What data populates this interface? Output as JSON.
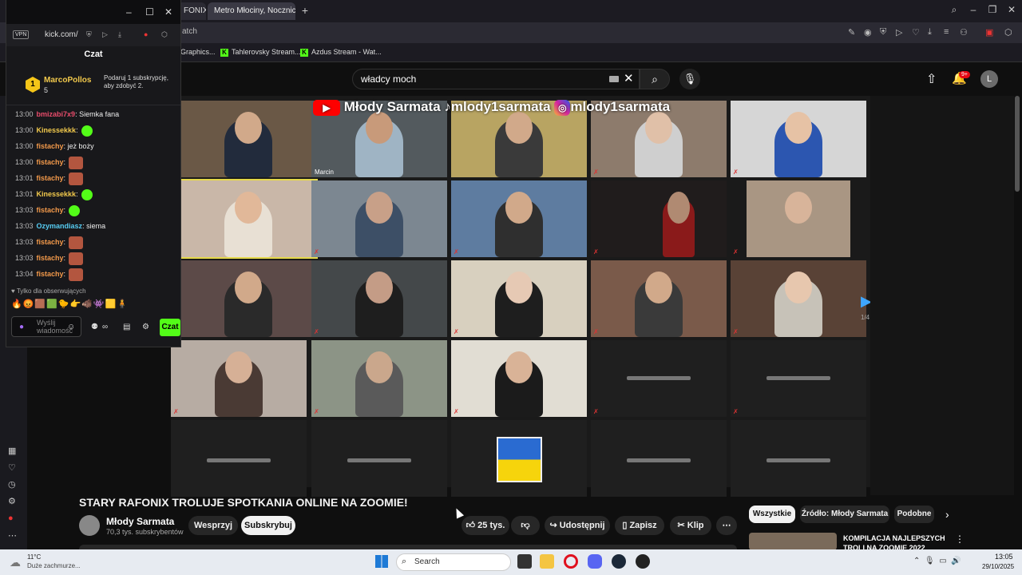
{
  "browser": {
    "tabs": [
      {
        "label": "FONIX"
      },
      {
        "label": "Metro Młociny, Nocznicki"
      }
    ],
    "address_fragment": "atch",
    "bookmarks": [
      "Graphics...",
      "Tahlerovsky Stream...",
      "Azdus Stream - Wat..."
    ]
  },
  "youtube": {
    "search_value": "władcy moch",
    "notification_badge": "9+",
    "avatar_letter": "L",
    "video_title": "STARY RAFONIX TROLUJE SPOTKANIA ONLINE NA ZOOMIE!",
    "channel_name": "Młody Sarmata",
    "channel_subs": "70,3 tys. subskrybentów",
    "support_label": "Wesprzyj",
    "subscribe_label": "Subskrybuj",
    "like_count": "25 tys.",
    "share_label": "Udostępnij",
    "save_label": "Zapisz",
    "clip_label": "Klip",
    "chips": [
      "Wszystkie",
      "Źródło: Młody Sarmata",
      "Podobne"
    ],
    "rec_title": "KOMPILACJA NAJLEPSZYCH TROLI NA ZOOMIE 2022",
    "watermark_handle_1": "Młody Sarmata",
    "watermark_handle_2": "mlody1sarmata",
    "watermark_handle_3": "mlody1sarmata",
    "tile_name": "Marcin",
    "page_indicator": "1/4"
  },
  "kick": {
    "url": "kick.com/",
    "vpn_label": "VPN",
    "chat_title": "Czat",
    "pinned": {
      "rank": "1",
      "user": "MarcoPollos",
      "count": "5",
      "message": "Podaruj 1 subskrypcję, aby zdobyć 2."
    },
    "messages": [
      {
        "time": "13:00",
        "user": "bmizabi7x9",
        "text": ": Siemka fana",
        "color": "#e84c6b"
      },
      {
        "time": "13:00",
        "user": "Kinessekkk",
        "text": ":",
        "color": "#f2c94c",
        "emote": "green"
      },
      {
        "time": "13:00",
        "user": "fistachy",
        "text": ": jeż boży",
        "color": "#f2994a"
      },
      {
        "time": "13:00",
        "user": "fistachy",
        "text": ":",
        "color": "#f2994a",
        "emote": "red"
      },
      {
        "time": "13:01",
        "user": "fistachy",
        "text": ":",
        "color": "#f2994a",
        "emote": "red"
      },
      {
        "time": "13:01",
        "user": "Kinessekkk",
        "text": ":",
        "color": "#f2c94c",
        "emote": "green"
      },
      {
        "time": "13:03",
        "user": "fistachy",
        "text": ":",
        "color": "#f2994a",
        "emote": "green"
      },
      {
        "time": "13:03",
        "user": "Ozymandiasz",
        "text": ": siema",
        "color": "#56ccf2"
      },
      {
        "time": "13:03",
        "user": "fistachy",
        "text": ":",
        "color": "#f2994a",
        "emote": "red"
      },
      {
        "time": "13:03",
        "user": "fistachy",
        "text": ":",
        "color": "#f2994a",
        "emote": "red"
      },
      {
        "time": "13:04",
        "user": "fistachy",
        "text": ":",
        "color": "#f2994a",
        "emote": "red"
      }
    ],
    "followers_only": "Tylko dla obserwujących",
    "input_placeholder": "Wyślij wiadomość",
    "send_label": "Czat"
  },
  "taskbar": {
    "weather_temp": "11°C",
    "weather_desc": "Duże zachmurze...",
    "search_label": "Search",
    "time": "13:05",
    "date": "29/10/2025"
  },
  "colors": {
    "kick_green": "#53fc18",
    "yt_red": "#ff0000",
    "active_speaker": "#e5d94a"
  }
}
